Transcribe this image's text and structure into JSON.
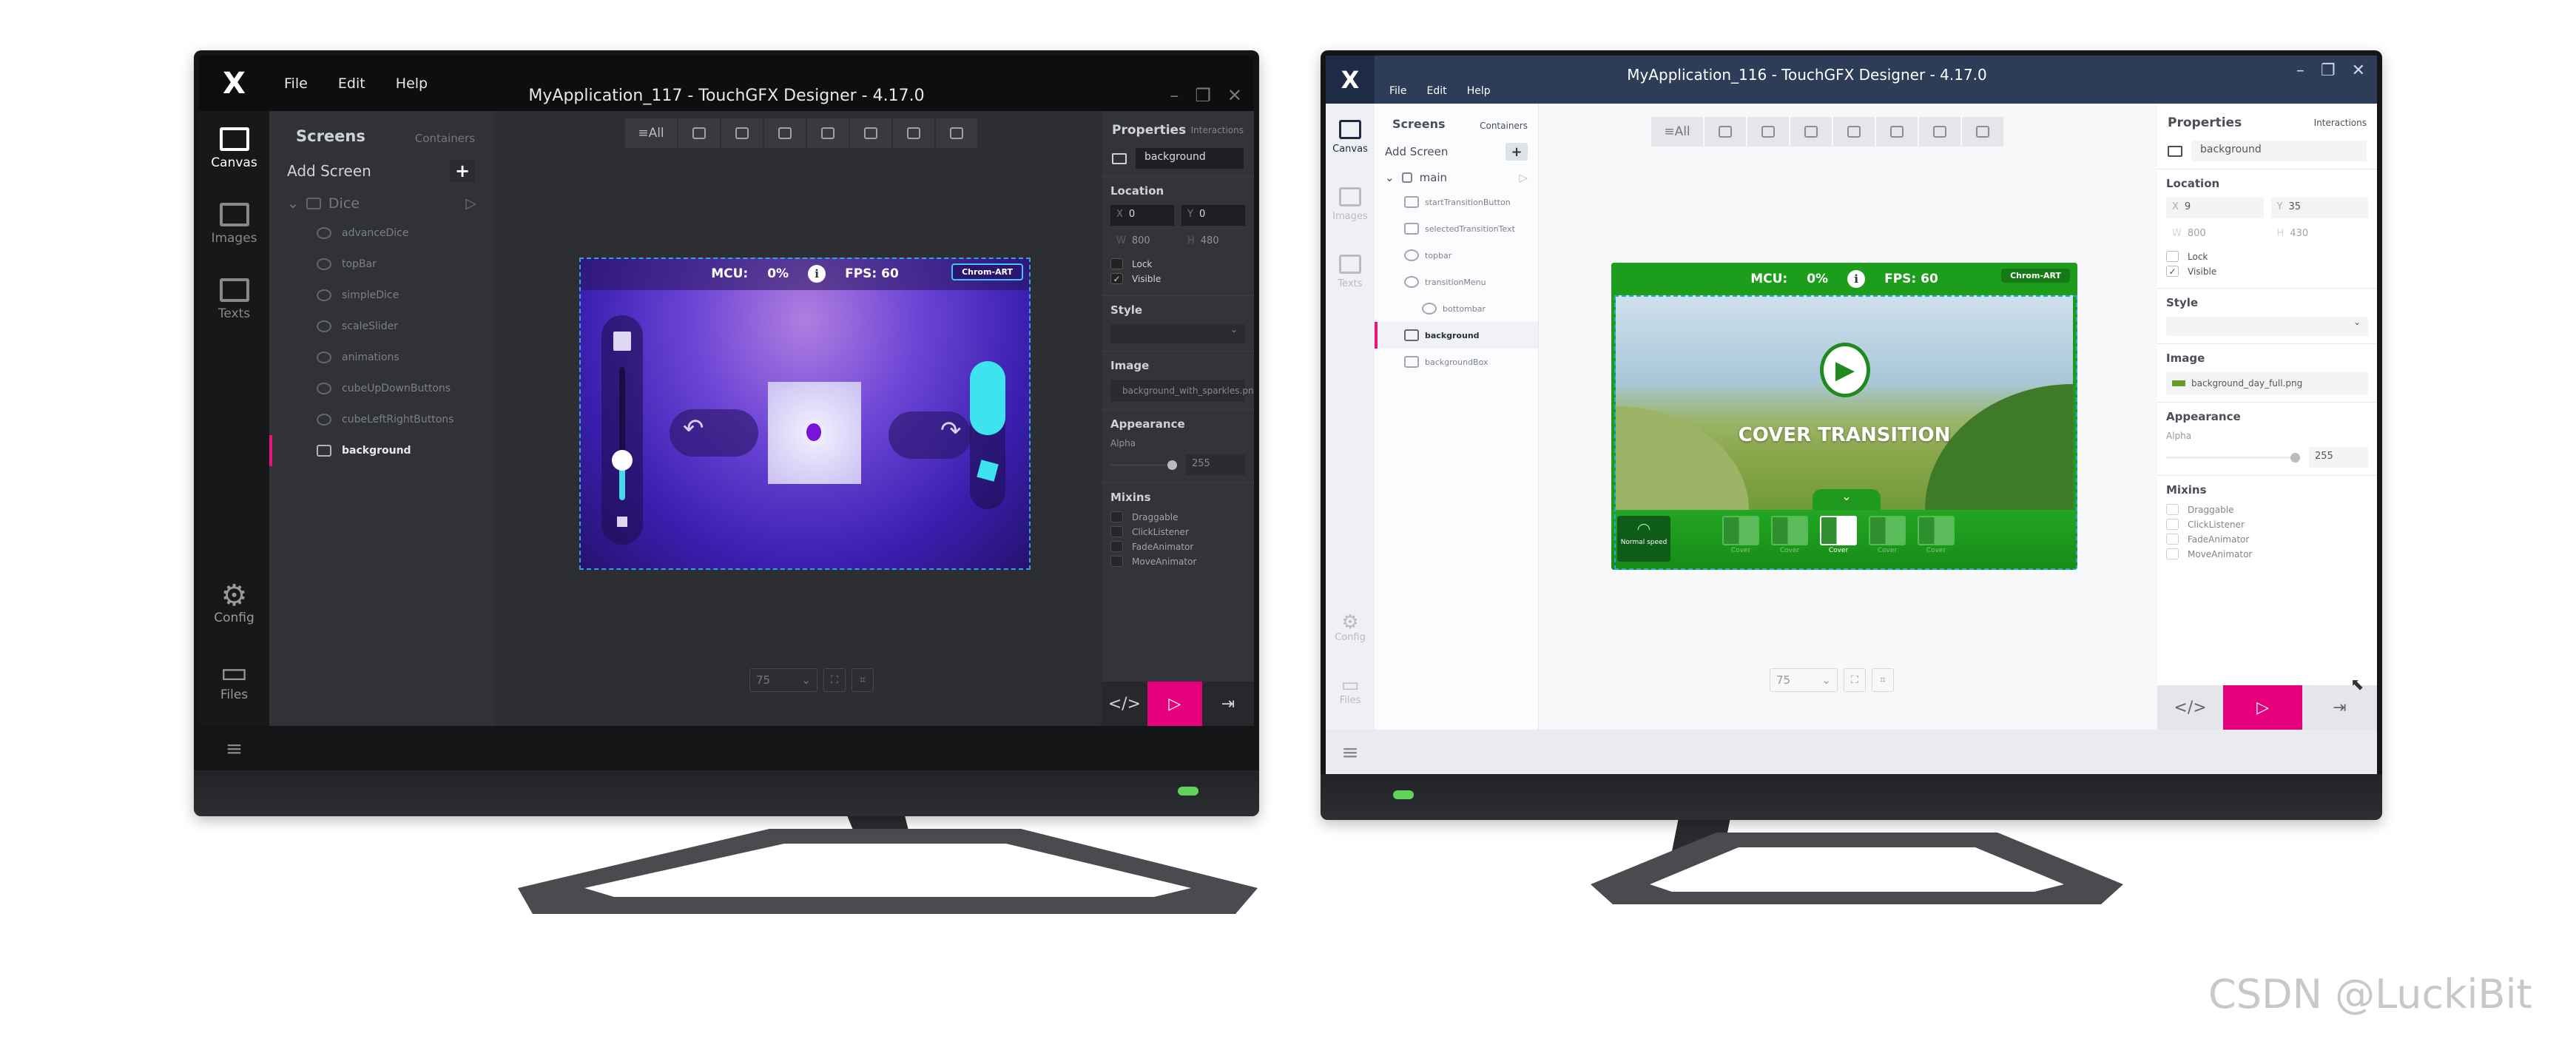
{
  "left_app": {
    "title": "MyApplication_117 - TouchGFX Designer - 4.17.0",
    "menu": [
      "File",
      "Edit",
      "Help"
    ],
    "rail": [
      {
        "label": "Canvas",
        "icon": "canvas-icon"
      },
      {
        "label": "Images",
        "icon": "images-icon"
      },
      {
        "label": "Texts",
        "icon": "texts-icon"
      }
    ],
    "rail_bottom": [
      {
        "label": "Config",
        "icon": "gear-icon"
      },
      {
        "label": "Files",
        "icon": "folder-icon"
      }
    ],
    "screens_tab": "Screens",
    "containers_tab": "Containers",
    "add_screen": "Add Screen",
    "screen_name": "Dice",
    "tree": [
      {
        "label": "advanceDice",
        "icon": "container-icon"
      },
      {
        "label": "topBar",
        "icon": "container-icon"
      },
      {
        "label": "simpleDice",
        "icon": "container-icon"
      },
      {
        "label": "scaleSlider",
        "icon": "container-icon"
      },
      {
        "label": "animations",
        "icon": "container-icon"
      },
      {
        "label": "cubeUpDownButtons",
        "icon": "container-icon"
      },
      {
        "label": "cubeLeftRightButtons",
        "icon": "container-icon"
      },
      {
        "label": "background",
        "icon": "image-icon",
        "selected": true
      }
    ],
    "toolbar_all": "All",
    "preview": {
      "mcu_label": "MCU:",
      "mcu_value": "0%",
      "fps": "FPS: 60",
      "chrom_art": "Chrom-ART",
      "scale_slider_level": 0.3
    },
    "zoom": "75",
    "properties": {
      "tab": "Properties",
      "interactions": "Interactions",
      "widget_name": "background",
      "location": "Location",
      "x": "0",
      "y": "0",
      "w": "800",
      "h": "480",
      "lock": "Lock",
      "lock_checked": false,
      "visible": "Visible",
      "visible_checked": true,
      "style": "Style",
      "image": "Image",
      "image_file": "background_with_sparkles.png",
      "appearance": "Appearance",
      "alpha_label": "Alpha",
      "alpha": "255",
      "mixins_label": "Mixins",
      "mixins": [
        "Draggable",
        "ClickListener",
        "FadeAnimator",
        "MoveAnimator"
      ]
    }
  },
  "right_app": {
    "title": "MyApplication_116 - TouchGFX Designer - 4.17.0",
    "menu": [
      "File",
      "Edit",
      "Help"
    ],
    "rail": [
      {
        "label": "Canvas",
        "icon": "canvas-icon"
      },
      {
        "label": "Images",
        "icon": "images-icon"
      },
      {
        "label": "Texts",
        "icon": "texts-icon"
      }
    ],
    "rail_bottom": [
      {
        "label": "Config",
        "icon": "gear-icon"
      },
      {
        "label": "Files",
        "icon": "folder-icon"
      }
    ],
    "screens_tab": "Screens",
    "containers_tab": "Containers",
    "add_screen": "Add Screen",
    "screen_name": "main",
    "tree": [
      {
        "label": "startTransitionButton",
        "icon": "button-icon"
      },
      {
        "label": "selectedTransitionText",
        "icon": "text-icon"
      },
      {
        "label": "topbar",
        "icon": "container-icon"
      },
      {
        "label": "transitionMenu",
        "icon": "container-icon"
      },
      {
        "label": "bottombar",
        "icon": "container-icon",
        "nested": true
      },
      {
        "label": "background",
        "icon": "image-icon",
        "selected": true
      },
      {
        "label": "backgroundBox",
        "icon": "box-icon"
      }
    ],
    "toolbar_all": "All",
    "preview": {
      "mcu_label": "MCU:",
      "mcu_value": "0%",
      "fps": "FPS: 60",
      "chrom_art": "Chrom-ART",
      "headline": "COVER TRANSITION",
      "speed": "Normal speed",
      "transitions": [
        "Cover",
        "Cover",
        "Cover",
        "Cover",
        "Cover"
      ],
      "selected_transition": 2
    },
    "zoom": "75",
    "properties": {
      "tab": "Properties",
      "interactions": "Interactions",
      "widget_name": "background",
      "location": "Location",
      "x": "9",
      "y": "35",
      "w": "800",
      "h": "430",
      "lock": "Lock",
      "lock_checked": false,
      "visible": "Visible",
      "visible_checked": true,
      "style": "Style",
      "image": "Image",
      "image_file": "background_day_full.png",
      "appearance": "Appearance",
      "alpha_label": "Alpha",
      "alpha": "255",
      "mixins_label": "Mixins",
      "mixins": [
        "Draggable",
        "ClickListener",
        "FadeAnimator",
        "MoveAnimator"
      ]
    }
  },
  "colors": {
    "accent": "#e6007e",
    "selection": "#2aa7d6",
    "dark_green": "#1f9a1f",
    "purple": "#4a2bb8"
  },
  "watermark": "CSDN @LuckiBit"
}
